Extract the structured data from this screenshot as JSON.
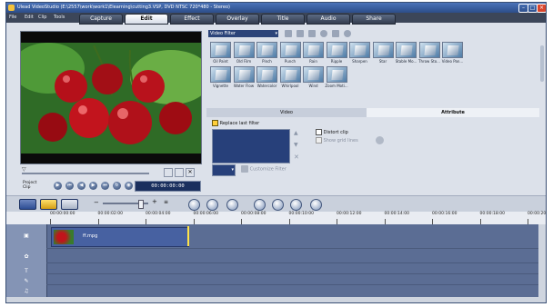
{
  "window": {
    "title": "Ulead VideoStudio (E:\\2557\\work\\work1\\Elearning\\cutting3.VSP, DVD NTSC 720*480 - Stereo)"
  },
  "menu": [
    "File",
    "Edit",
    "Clip",
    "Tools"
  ],
  "steps": [
    {
      "label": "Capture",
      "active": false
    },
    {
      "label": "Edit",
      "active": true
    },
    {
      "label": "Effect",
      "active": false
    },
    {
      "label": "Overlay",
      "active": false
    },
    {
      "label": "Title",
      "active": false
    },
    {
      "label": "Audio",
      "active": false
    },
    {
      "label": "Share",
      "active": false
    }
  ],
  "player": {
    "mode_label": "Project",
    "mode_sublabel": "Clip",
    "timecode": "00:00:00:00"
  },
  "library": {
    "dropdown": "Video Filter",
    "filters": [
      "Oil Paint",
      "Old Film",
      "Pinch",
      "Punch",
      "Rain",
      "Ripple",
      "Sharpen",
      "Star",
      "Stable Mo...",
      "Throw Sto...",
      "Video Pan...",
      "Vignette",
      "Water Flow",
      "Watercolor",
      "Whirlpool",
      "Wind",
      "Zoom Moti..."
    ]
  },
  "options": {
    "tabs": [
      {
        "label": "Video",
        "active": false
      },
      {
        "label": "Attribute",
        "active": true
      }
    ],
    "replace_last_filter": "Replace last filter",
    "distort_clip": "Distort clip",
    "show_grid_lines": "Show grid lines",
    "customize_filter": "Customize Filter"
  },
  "timeline": {
    "ticks": [
      "00:00:00:00",
      "00:00:02:00",
      "00:00:04:00",
      "00:00:06:00",
      "00:00:08:00",
      "00:00:10:00",
      "00:00:12:00",
      "00:00:14:00",
      "00:00:16:00",
      "00:00:18:00",
      "00:00:20:"
    ],
    "clip_name": "ff.mpg"
  },
  "colors": {
    "active_step": "#ffffff",
    "timeline_bg": "#5b6d94",
    "clip": "#4761a1",
    "playhead": "#ffe34a"
  }
}
